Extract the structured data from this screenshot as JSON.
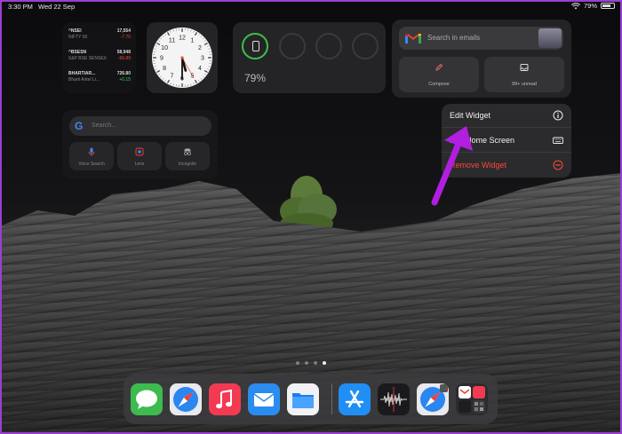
{
  "status_bar": {
    "time": "3:30 PM",
    "date": "Wed 22 Sep",
    "battery_percent": "79%",
    "battery_level": 0.79,
    "wifi_icon": "wifi-icon",
    "battery_icon": "battery-icon"
  },
  "stocks_widget": {
    "items": [
      {
        "symbol": "^NSEI",
        "value": "17,554",
        "name": "NIFTY 50",
        "change": "-7.70",
        "change_color": "#ff453a"
      },
      {
        "symbol": "^BSESN",
        "value": "58,948",
        "name": "S&P BSE SENSEX",
        "change": "-56.89",
        "change_color": "#ff453a"
      },
      {
        "symbol": "BHARTIAR...",
        "value": "726.80",
        "name": "Bharti Airtel Li...",
        "change": "+0.15",
        "change_color": "#30d158"
      }
    ]
  },
  "clock_widget": {
    "hour": 5,
    "minute": 30,
    "second": 25
  },
  "batteries_widget": {
    "percent_label": "79%",
    "level": 0.79,
    "device_icon": "iphone-icon",
    "accent_color": "#3fbf4a"
  },
  "gmail_widget": {
    "search_placeholder": "Search in emails",
    "compose_label": "Compose",
    "unread_label": "99+ unread",
    "logo_icon": "gmail-logo-icon"
  },
  "google_widget": {
    "search_placeholder": "Search...",
    "logo_letter": "G",
    "buttons": [
      {
        "label": "Voice Search",
        "icon": "microphone-icon"
      },
      {
        "label": "Lens",
        "icon": "lens-camera-icon"
      },
      {
        "label": "Incognito",
        "icon": "incognito-icon"
      }
    ]
  },
  "context_menu": {
    "items": [
      {
        "label": "Edit Widget",
        "icon": "info-circle-icon",
        "danger": false
      },
      {
        "label": "Edit Home Screen",
        "icon": "keyboard-icon",
        "danger": false
      },
      {
        "label": "Remove Widget",
        "icon": "minus-circle-icon",
        "danger": true
      }
    ]
  },
  "annotation": {
    "arrow_color": "#b21ee0"
  },
  "page_dots": {
    "count": 4,
    "active_index": 3
  },
  "dock": {
    "apps": [
      {
        "name": "Messages",
        "icon": "messages-icon"
      },
      {
        "name": "Safari",
        "icon": "safari-icon"
      },
      {
        "name": "Music",
        "icon": "music-icon"
      },
      {
        "name": "Mail",
        "icon": "mail-icon"
      },
      {
        "name": "Files",
        "icon": "files-icon"
      },
      {
        "name": "App Store",
        "icon": "app-store-icon"
      },
      {
        "name": "Voice Memos",
        "icon": "voice-memos-icon"
      },
      {
        "name": "Safari",
        "icon": "safari-icon"
      },
      {
        "name": "App Library",
        "icon": "app-library-icon"
      }
    ]
  }
}
